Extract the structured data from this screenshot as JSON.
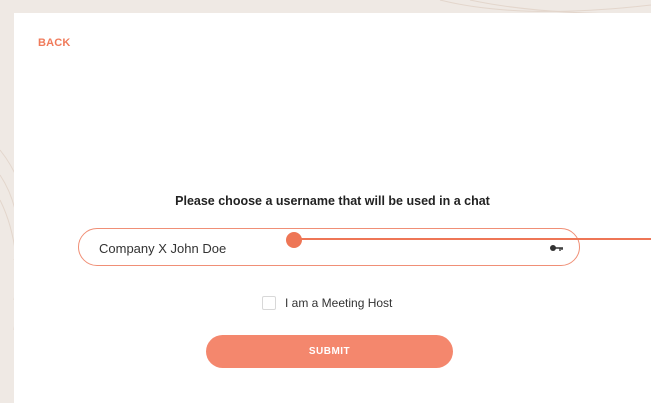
{
  "nav": {
    "back_label": "BACK"
  },
  "form": {
    "prompt": "Please choose a username that will be used in a chat",
    "username_value": "Company X John Doe",
    "host_checkbox_label": "I am a Meeting Host",
    "host_checked": false,
    "submit_label": "SUBMIT"
  },
  "colors": {
    "accent": "#f07b5b",
    "submit_bg": "#f4876d",
    "field_border": "#f08f76"
  }
}
